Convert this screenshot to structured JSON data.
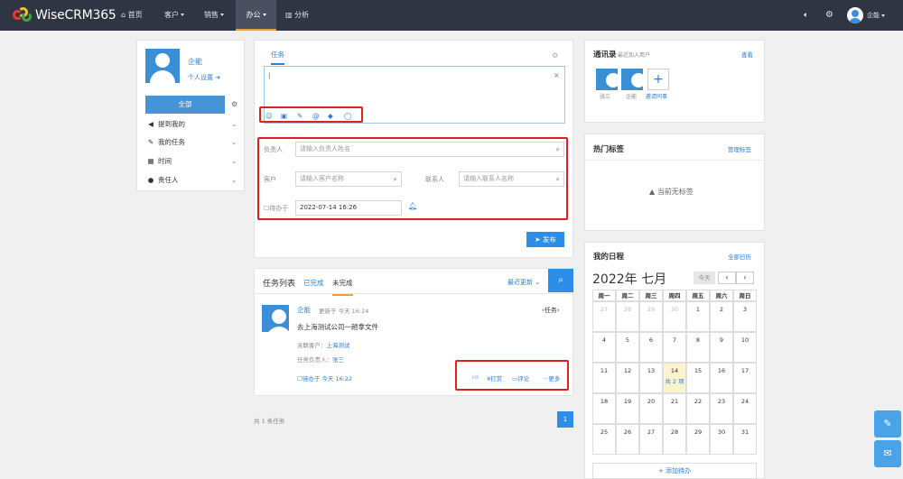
{
  "nav": {
    "brand": "WiseCRM365",
    "home": "首页",
    "customer": "客户",
    "sales": "销售",
    "office": "办公",
    "analysis": "分析",
    "user": "企能"
  },
  "profile": {
    "name": "企能",
    "settings": "个人设置",
    "all": "全部",
    "menu": [
      "提到我的",
      "我的任务",
      "时间",
      "责任人"
    ]
  },
  "task_form": {
    "tab": "任务",
    "owner_label": "负责人",
    "owner_placeholder": "请输入负责人姓名",
    "customer_label": "客户",
    "customer_placeholder": "请输入客户名称",
    "contact_label": "联系人",
    "contact_placeholder": "请输入联系人名称",
    "todo_label": "待办于",
    "todo_value": "2022-07-14 16:26",
    "publish": "发布"
  },
  "task_list": {
    "title": "任务列表",
    "tab_done": "已完成",
    "tab_undone": "未完成",
    "sort": "最近更新",
    "item": {
      "author": "企能",
      "updated": "更新于 今天 16:24",
      "tag": "‹任务›",
      "content": "去上海测试公司一趟拿文件",
      "customer_label": "关联客户：",
      "customer": "上海测试",
      "owner_label": "任务负责人：",
      "owner": "张三",
      "todo": "待办于 今天 16:22",
      "reward": "打赏",
      "comment": "评论",
      "more": "更多"
    },
    "total": "共 1 条任务",
    "page": "1"
  },
  "contacts": {
    "title": "通讯录",
    "subtitle": "最近加入用户",
    "view": "查看",
    "users": [
      "张三",
      "企能"
    ],
    "invite": "邀请同事"
  },
  "hot_tags": {
    "title": "热门标签",
    "manage": "管理标签",
    "empty": "当前无标签"
  },
  "schedule": {
    "title": "我的日程",
    "all": "全部日历",
    "month": "2022年 七月",
    "today": "今天",
    "weekdays": [
      "周一",
      "周二",
      "周三",
      "周四",
      "周五",
      "周六",
      "周日"
    ],
    "weeks": [
      [
        "27",
        "28",
        "29",
        "30",
        "1",
        "2",
        "3"
      ],
      [
        "4",
        "5",
        "6",
        "7",
        "8",
        "9",
        "10"
      ],
      [
        "11",
        "12",
        "13",
        "14",
        "15",
        "16",
        "17"
      ],
      [
        "18",
        "19",
        "20",
        "21",
        "22",
        "23",
        "24"
      ],
      [
        "25",
        "26",
        "27",
        "28",
        "29",
        "30",
        "31"
      ]
    ],
    "event": "共 2 项",
    "add": "+ 添加待办"
  }
}
